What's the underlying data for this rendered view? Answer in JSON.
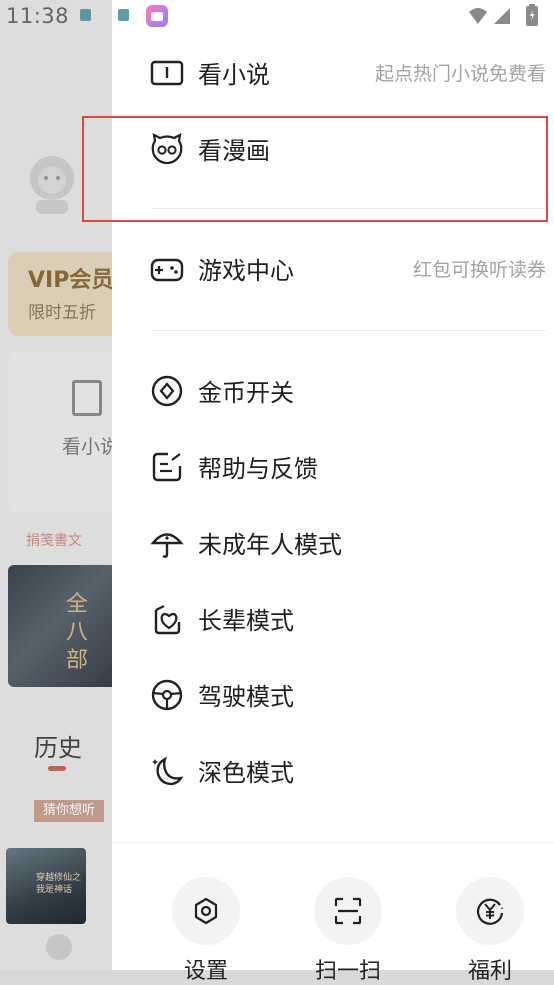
{
  "status": {
    "time": "11:38"
  },
  "background": {
    "vip_title": "VIP会员",
    "vip_sub": "限时五折",
    "book_label": "看小说",
    "rec_tag": "捐笺書文",
    "cover1_text": "全八部",
    "history_title": "历史",
    "guess_tag": "猜你想听",
    "cover2_text": "穿越修仙之我是神话"
  },
  "menu": {
    "items": [
      {
        "label": "看小说",
        "sub": "起点热门小说免费看",
        "icon": "book-icon"
      },
      {
        "label": "看漫画",
        "sub": "",
        "icon": "comic-mascot-icon"
      },
      {
        "label": "游戏中心",
        "sub": "红包可换听读券",
        "icon": "gamepad-icon"
      },
      {
        "label": "金币开关",
        "sub": "",
        "icon": "coin-icon"
      },
      {
        "label": "帮助与反馈",
        "sub": "",
        "icon": "feedback-icon"
      },
      {
        "label": "未成年人模式",
        "sub": "",
        "icon": "umbrella-icon"
      },
      {
        "label": "长辈模式",
        "sub": "",
        "icon": "elder-heart-icon"
      },
      {
        "label": "驾驶模式",
        "sub": "",
        "icon": "steering-wheel-icon"
      },
      {
        "label": "深色模式",
        "sub": "",
        "icon": "moon-icon"
      }
    ]
  },
  "bottom": {
    "items": [
      {
        "label": "设置",
        "icon": "gear-icon"
      },
      {
        "label": "扫一扫",
        "icon": "scan-icon"
      },
      {
        "label": "福利",
        "icon": "yen-coin-icon"
      }
    ]
  },
  "colors": {
    "highlight": "#d9493e",
    "text": "#1f1f1f",
    "subtext": "#a3a3a3"
  }
}
